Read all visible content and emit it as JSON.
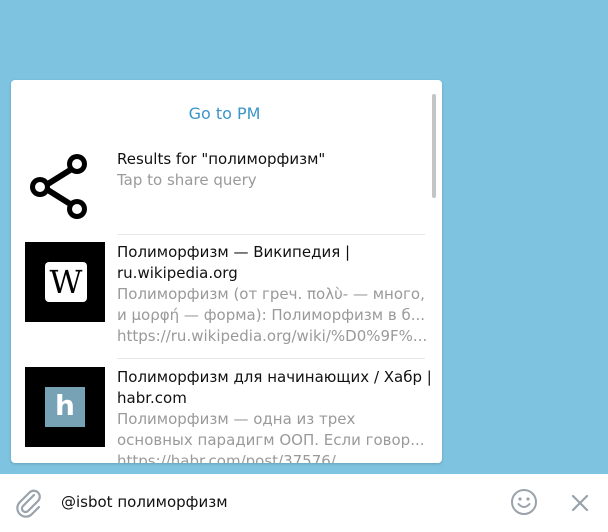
{
  "popup": {
    "go_to_pm": "Go to PM",
    "share_item": {
      "icon": "share-icon",
      "title": "Results for \"полиморфизм\"",
      "subtitle": "Tap to share query"
    },
    "results": [
      {
        "thumb_letter": "W",
        "title": "Полиморфизм — Википедия | ru.wikipedia.org",
        "line1": "Полиморфизм (от греч. πολὺ- — много,",
        "line2": "и μορφή — форма): Полиморфизм в б...",
        "url": "https://ru.wikipedia.org/wiki/%D0%9F%..."
      },
      {
        "thumb_letter": "h",
        "title": "Полиморфизм для начинающих / Хабр | habr.com",
        "line1": "Полиморфизм — одна из трех",
        "line2": "основных парадигм ООП. Если говор...",
        "url": "https://habr.com/post/37576/"
      }
    ]
  },
  "input": {
    "value": "@isbot полиморфизм"
  },
  "colors": {
    "background": "#7ec4e1",
    "accent": "#3a95c8"
  }
}
